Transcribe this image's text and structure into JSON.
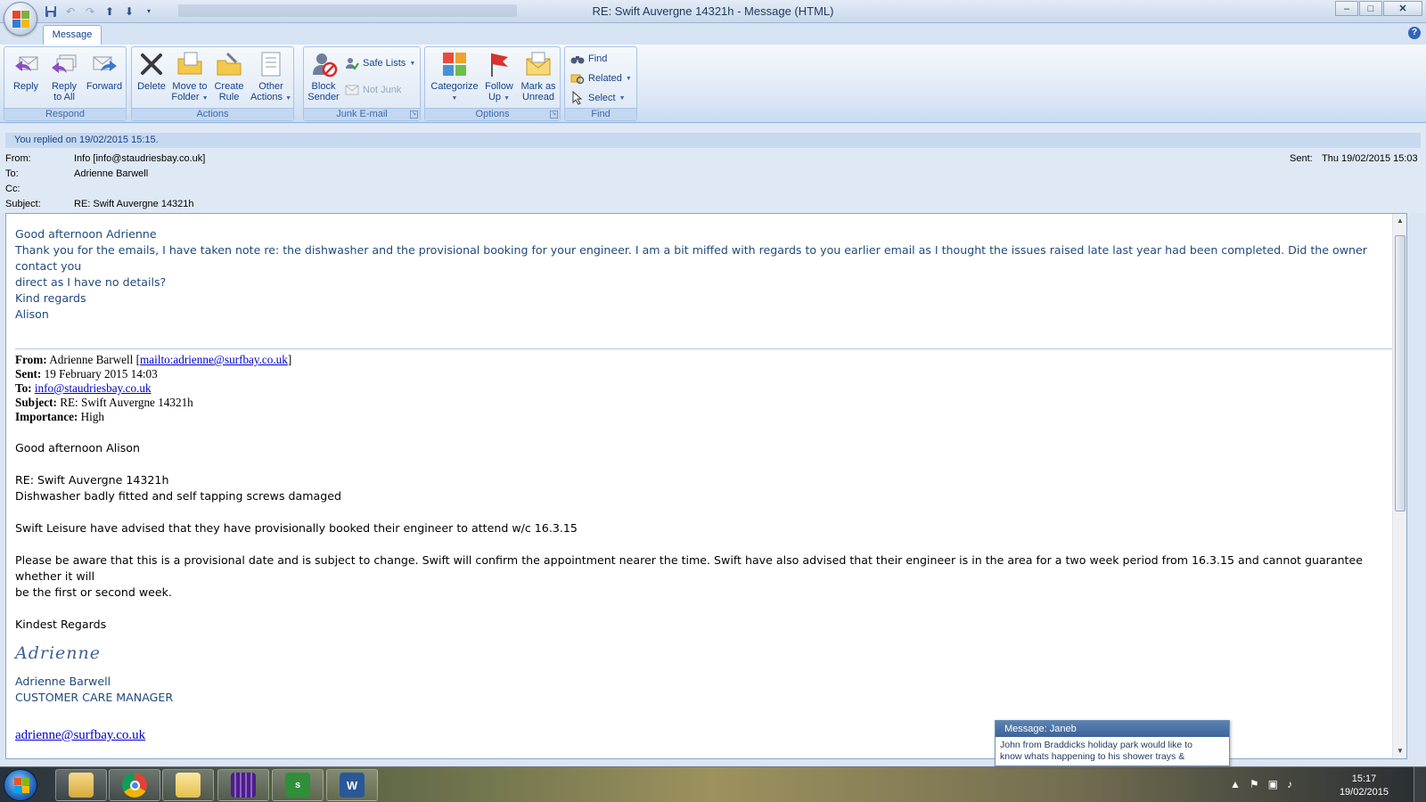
{
  "window": {
    "title": "RE: Swift Auvergne 14321h - Message (HTML)",
    "controls": {
      "minimize": "–",
      "maximize": "□",
      "close": "✕"
    }
  },
  "ribbon": {
    "active_tab": "Message",
    "groups": {
      "respond": {
        "label": "Respond",
        "reply": "Reply",
        "reply_all_line1": "Reply",
        "reply_all_line2": "to All",
        "forward": "Forward"
      },
      "actions": {
        "label": "Actions",
        "delete": "Delete",
        "move_line1": "Move to",
        "move_line2": "Folder",
        "create_line1": "Create",
        "create_line2": "Rule",
        "other_line1": "Other",
        "other_line2": "Actions"
      },
      "junk": {
        "label": "Junk E-mail",
        "block_line1": "Block",
        "block_line2": "Sender",
        "safe_lists": "Safe Lists",
        "not_junk": "Not Junk"
      },
      "options": {
        "label": "Options",
        "categorize": "Categorize",
        "follow_line1": "Follow",
        "follow_line2": "Up",
        "mark_line1": "Mark as",
        "mark_line2": "Unread"
      },
      "find": {
        "label": "Find",
        "find": "Find",
        "related": "Related",
        "select": "Select"
      }
    }
  },
  "header": {
    "info_bar": "You replied on 19/02/2015 15:15.",
    "from_label": "From:",
    "from_value": "Info [info@staudriesbay.co.uk]",
    "to_label": "To:",
    "to_value": "Adrienne Barwell",
    "cc_label": "Cc:",
    "subject_label": "Subject:",
    "subject_value": "RE: Swift Auvergne 14321h",
    "sent_label": "Sent:",
    "sent_value": "Thu 19/02/2015 15:03"
  },
  "reply": {
    "greeting": "Good afternoon Adrienne",
    "para_line1": "Thank you for the emails,  I have taken note re: the dishwasher and the provisional booking for your engineer.  I am a bit miffed with regards to you earlier email as I thought the issues raised late last year had been completed.  Did the owner contact you",
    "para_line2": "direct as I have no details?",
    "closing": "Kind regards",
    "name": "Alison"
  },
  "quoted": {
    "from_label": "From:",
    "from_name": "Adrienne Barwell [",
    "from_link": "mailto:adrienne@surfbay.co.uk",
    "from_close": "]",
    "sent_label": "Sent:",
    "sent_value": "19 February 2015 14:03",
    "to_label": "To:",
    "to_link": "info@staudriesbay.co.uk",
    "subject_label": "Subject:",
    "subject_value": "RE: Swift Auvergne 14321h",
    "importance_label": "Importance:",
    "importance_value": "High",
    "greeting": "Good afternoon Alison",
    "ref_line": "RE: Swift Auvergne 14321h",
    "issue_line": "Dishwasher badly fitted and self tapping screws damaged",
    "para1": "Swift Leisure have advised that they have provisionally booked their engineer to attend w/c 16.3.15",
    "para2_line1": "Please be aware that this is a provisional date and is subject to change.  Swift will confirm the appointment nearer the time.  Swift have also advised that their engineer is in the area for a two week period from 16.3.15 and cannot guarantee whether it will",
    "para2_line2": "be the first or second week.",
    "closing": "Kindest Regards",
    "signature": "Adrienne",
    "sig_name": "Adrienne Barwell",
    "sig_title": "CUSTOMER CARE MANAGER",
    "sig_email": "adrienne@surfbay.co.uk"
  },
  "notification": {
    "title": "Message: Janeb",
    "body_line1": "John from Braddicks holiday park   would like to",
    "body_line2": "know whats happening to his shower trays &"
  },
  "taskbar": {
    "clock_time": "15:17",
    "clock_date": "19/02/2015"
  },
  "colors": {
    "accent_blue": "#15428b",
    "body_blue_text": "#1f497d",
    "link": "#0000cc"
  }
}
